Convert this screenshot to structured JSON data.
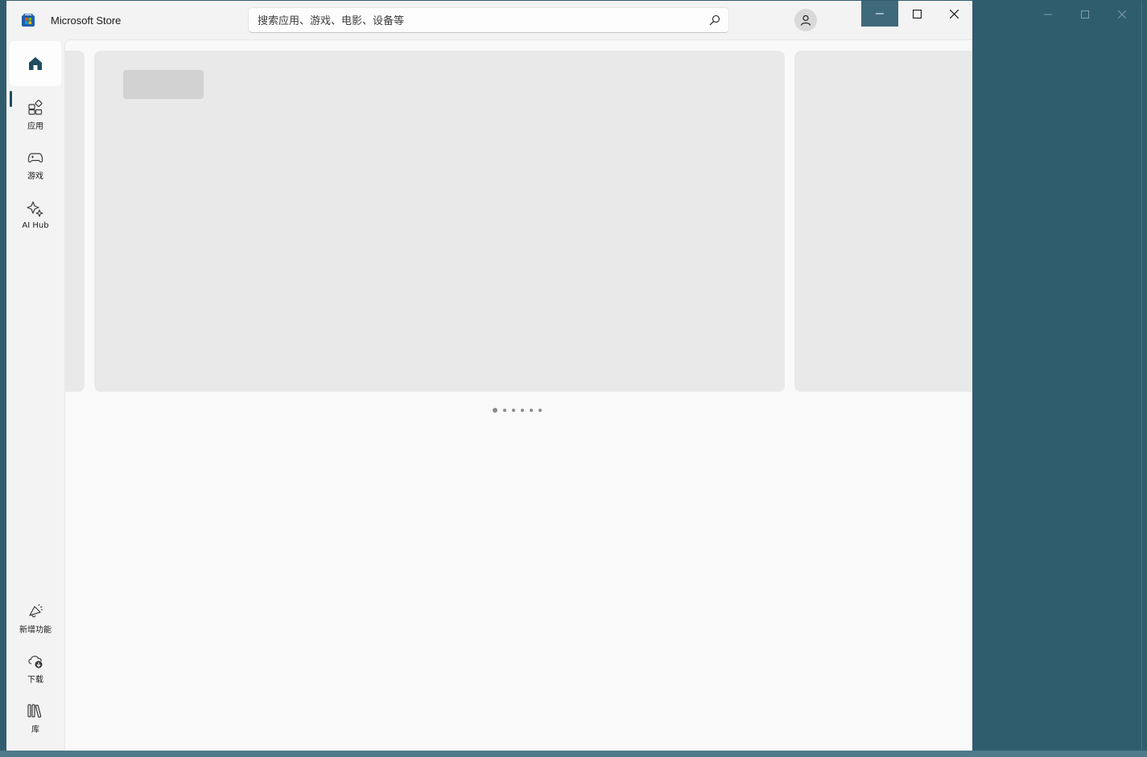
{
  "app": {
    "title": "Microsoft Store"
  },
  "search": {
    "placeholder": "搜索应用、游戏、电影、设备等"
  },
  "nav": {
    "top": [
      {
        "label": "",
        "icon": "home-icon"
      },
      {
        "label": "应用",
        "icon": "apps-icon"
      },
      {
        "label": "游戏",
        "icon": "gamepad-icon"
      },
      {
        "label": "AI Hub",
        "icon": "sparkle-icon"
      }
    ],
    "bottom": [
      {
        "label": "新增功能",
        "icon": "megaphone-icon"
      },
      {
        "label": "下载",
        "icon": "cloud-download-icon"
      },
      {
        "label": "库",
        "icon": "library-icon"
      }
    ]
  },
  "carousel": {
    "slide_count": 6,
    "active_index": 0
  },
  "colors": {
    "desktop": "#305d6e",
    "accent": "#1f4c5e",
    "skeleton": "#e9e9e9"
  }
}
